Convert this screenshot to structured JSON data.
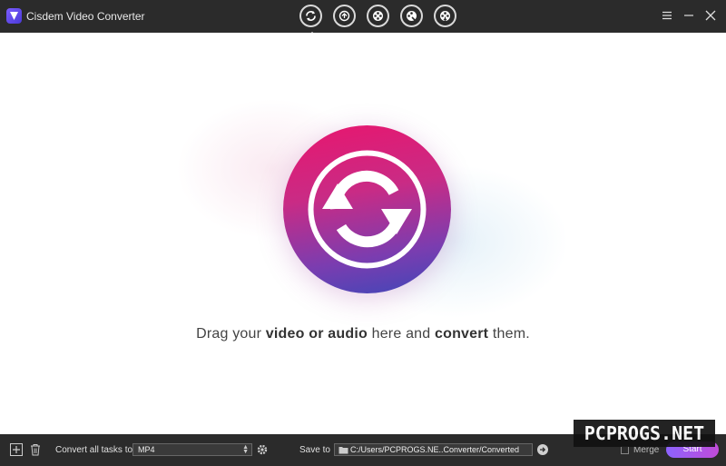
{
  "app": {
    "title": "Cisdem Video Converter"
  },
  "mode_tabs": [
    {
      "icon": "convert-icon",
      "active": true
    },
    {
      "icon": "compress-icon",
      "active": false
    },
    {
      "icon": "film-reel-icon",
      "active": false
    },
    {
      "icon": "film-edit-icon",
      "active": false
    },
    {
      "icon": "film-download-icon",
      "active": false
    }
  ],
  "window_controls": [
    "menu-icon",
    "minimize-icon",
    "close-icon"
  ],
  "main": {
    "hint_prefix": "Drag your ",
    "hint_bold_1": "video or audio",
    "hint_middle": " here and ",
    "hint_bold_2": "convert",
    "hint_suffix": " them."
  },
  "bottombar": {
    "convert_all_label": "Convert all tasks to",
    "format_value": "MP4",
    "save_to_label": "Save to",
    "save_path": "C:/Users/PCPROGS.NE..Converter/Converted",
    "merge_label": "Merge",
    "start_label": "Start"
  },
  "watermark": "PCPROGS.NET",
  "colors": {
    "titlebar": "#2b2b2b",
    "accent_start": "#8d63ff",
    "circle_top": "#e8166e",
    "circle_bottom": "#4047b8"
  }
}
